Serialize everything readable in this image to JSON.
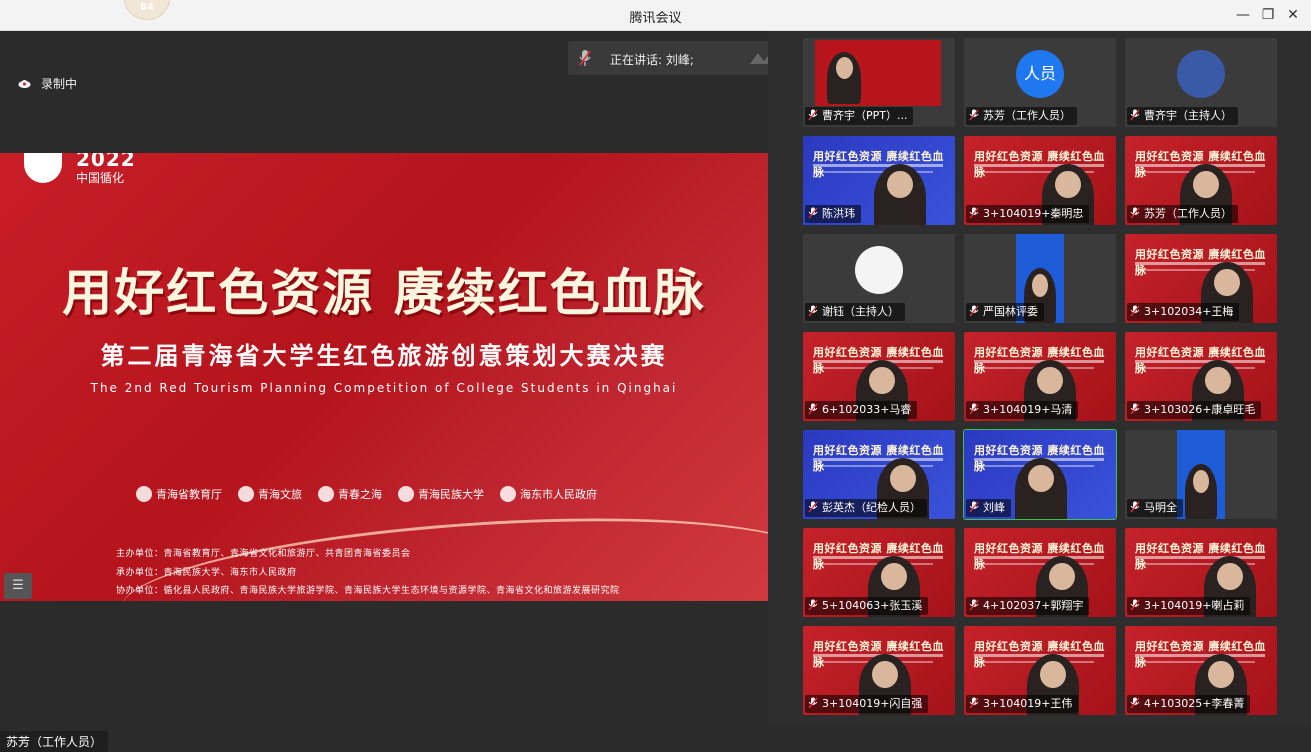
{
  "window": {
    "title": "腾讯会议",
    "badge": "84"
  },
  "main": {
    "recording_label": "录制中",
    "speaking_label": "正在讲话: 刘峰;",
    "bottom_name": "苏芳（工作人员）",
    "slide": {
      "year": "2022",
      "place": "中国循化",
      "headline": "用好红色资源 赓续红色血脉",
      "subtitle": "第二届青海省大学生红色旅游创意策划大赛决赛",
      "english": "The 2nd Red Tourism Planning Competition of College Students in Qinghai",
      "logos": [
        "青海省教育厅",
        "青海文旅",
        "青春之海",
        "青海民族大学",
        "海东市人民政府"
      ],
      "organizers": [
        "主办单位：青海省教育厅、青海省文化和旅游厅、共青团青海省委员会",
        "承办单位：青海民族大学、海东市人民政府",
        "协办单位：循化县人民政府、青海民族大学旅游学院、青海民族大学生态环境与资源学院、青海省文化和旅游发展研究院"
      ]
    }
  },
  "gallery": {
    "tiles": [
      {
        "name": "曹齐宇（PPT）...",
        "scene": "ppt"
      },
      {
        "name": "苏芳（工作人员）",
        "scene": "icon",
        "icon_text": "人员"
      },
      {
        "name": "曹齐宇（主持人）",
        "scene": "avatar"
      },
      {
        "name": "陈洪玮",
        "scene": "blue"
      },
      {
        "name": "3+104019+秦明忠",
        "scene": "red"
      },
      {
        "name": "苏芳（工作人员）",
        "scene": "red"
      },
      {
        "name": "谢钰（主持人）",
        "scene": "avatar2"
      },
      {
        "name": "严国林评委",
        "scene": "portrait"
      },
      {
        "name": "3+102034+王梅",
        "scene": "red"
      },
      {
        "name": "6+102033+马睿",
        "scene": "red"
      },
      {
        "name": "3+104019+马清",
        "scene": "red"
      },
      {
        "name": "3+103026+康卓旺毛",
        "scene": "red"
      },
      {
        "name": "彭英杰（纪检人员）",
        "scene": "blue"
      },
      {
        "name": "刘峰",
        "scene": "blue",
        "active": true
      },
      {
        "name": "马明全",
        "scene": "portrait"
      },
      {
        "name": "5+104063+张玉溪",
        "scene": "red"
      },
      {
        "name": "4+102037+郭翔宇",
        "scene": "red"
      },
      {
        "name": "3+104019+喇占莉",
        "scene": "red"
      },
      {
        "name": "3+104019+闪自强",
        "scene": "red"
      },
      {
        "name": "3+104019+王伟",
        "scene": "red"
      },
      {
        "name": "4+103025+李春菁",
        "scene": "red"
      }
    ],
    "slide_headline_short": "用好红色资源 赓续红色血脉"
  }
}
